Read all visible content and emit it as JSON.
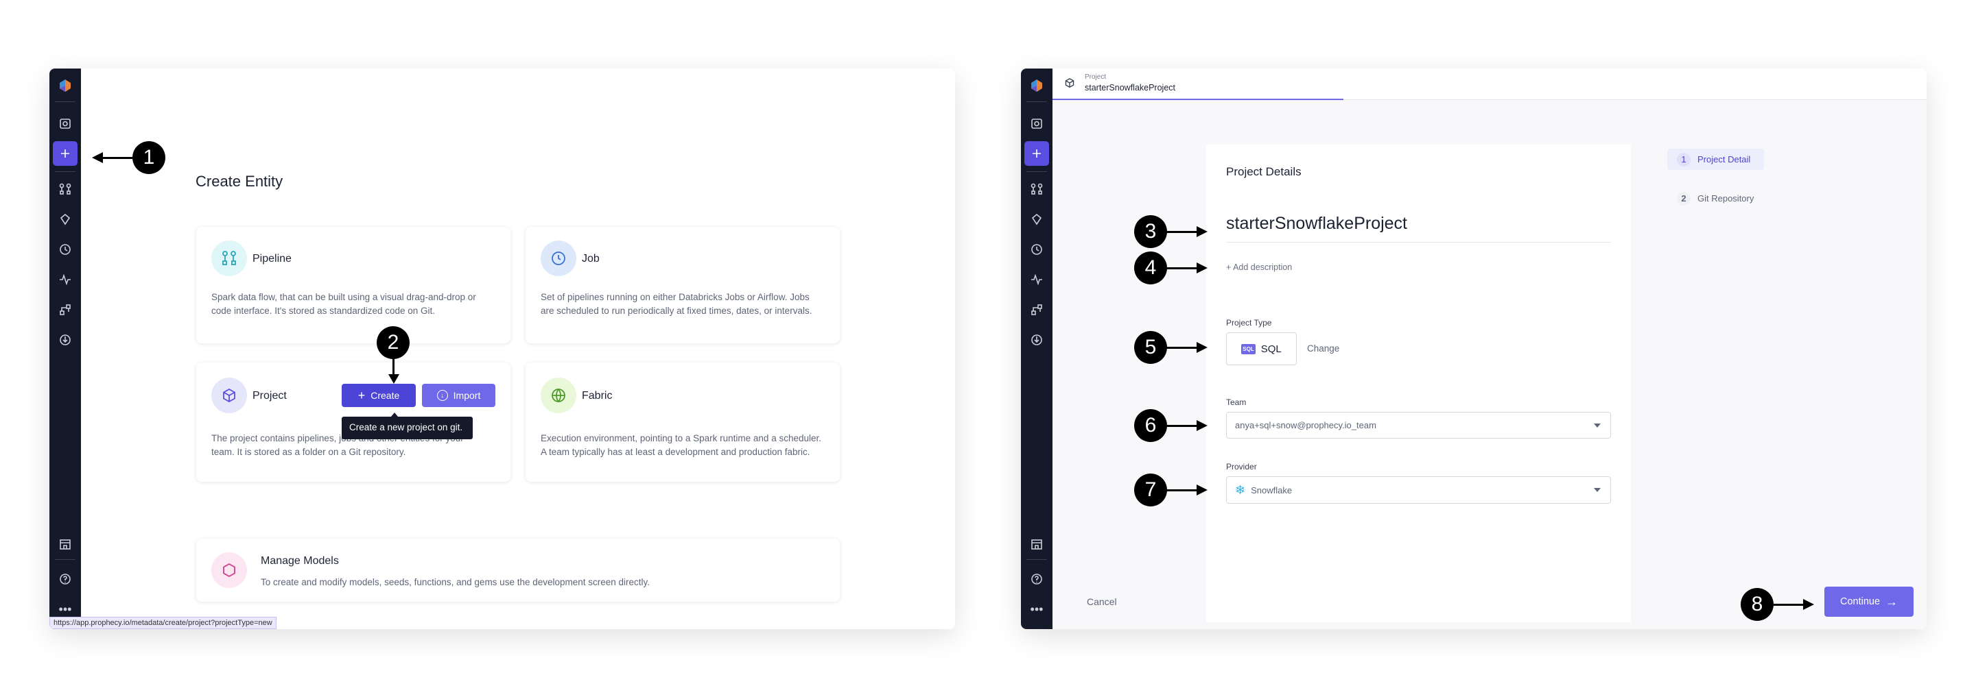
{
  "left": {
    "page_title": "Create Entity",
    "cards": [
      {
        "title": "Pipeline",
        "desc1": "Spark data flow, that can be built using a visual drag-and-drop or",
        "desc2": "code interface. It's stored as standardized code on Git.",
        "icon": "pipeline-icon"
      },
      {
        "title": "Job",
        "desc1": "Set of pipelines running on either Databricks Jobs or Airflow. Jobs",
        "desc2": "are scheduled to run periodically at fixed times, dates, or intervals.",
        "icon": "clock-icon"
      },
      {
        "title": "Project",
        "desc1": "The project contains pipelines, jobs and other entities for your",
        "desc2": "team. It is stored as a folder on a Git repository.",
        "icon": "cube-icon"
      },
      {
        "title": "Fabric",
        "desc1": "Execution environment, pointing to a Spark runtime and a scheduler.",
        "desc2": "A team typically has at least a development and production fabric.",
        "icon": "globe-icon"
      }
    ],
    "create_label": "Create",
    "import_label": "Import",
    "tooltip": "Create a new project on git.",
    "manage": {
      "title": "Manage Models",
      "desc": "To create and modify models, seeds, functions, and gems use the development screen directly."
    },
    "status_url": "https://app.prophecy.io/metadata/create/project?projectType=new"
  },
  "right": {
    "tab": {
      "kind": "Project",
      "name": "starterSnowflakeProject"
    },
    "form_title": "Project Details",
    "project_name": "starterSnowflakeProject",
    "add_description": "Add description",
    "project_type_label": "Project Type",
    "project_type": "SQL",
    "sql_badge": "SQL",
    "change_label": "Change",
    "team_label": "Team",
    "team_value": "anya+sql+snow@prophecy.io_team",
    "provider_label": "Provider",
    "provider_value": "Snowflake",
    "steps": [
      {
        "num": "1",
        "label": "Project Detail",
        "active": true
      },
      {
        "num": "2",
        "label": "Git Repository",
        "active": false
      }
    ],
    "cancel_label": "Cancel",
    "continue_label": "Continue"
  },
  "callouts": [
    "1",
    "2",
    "3",
    "4",
    "5",
    "6",
    "7",
    "8"
  ],
  "colors": {
    "accent": "#5a4ee0",
    "sidebar": "#141a2a",
    "import": "#6f68e8"
  }
}
